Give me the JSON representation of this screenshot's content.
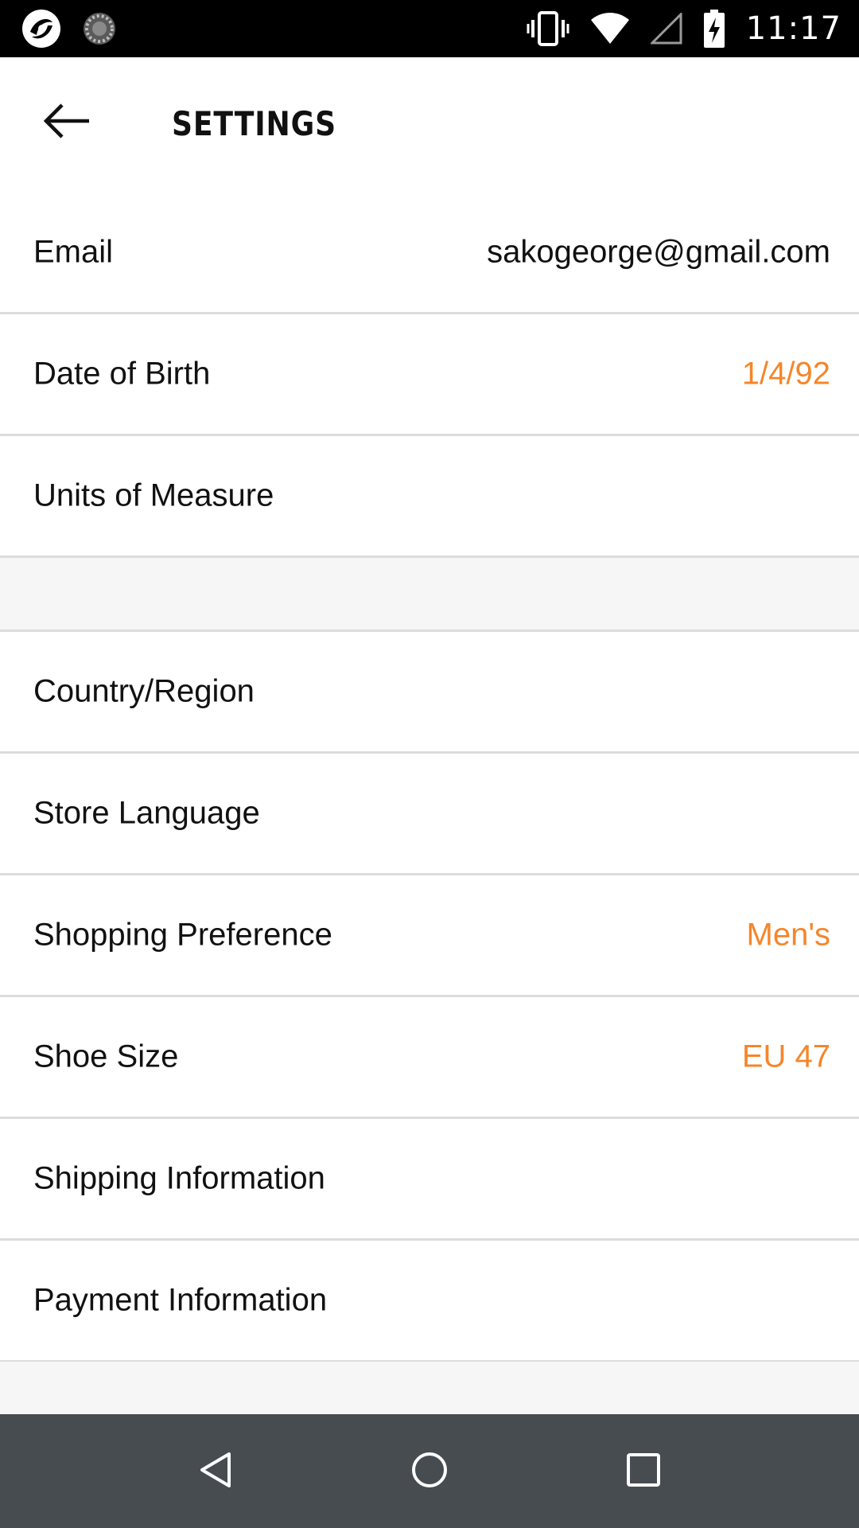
{
  "status_bar": {
    "time": "11:17",
    "icons": [
      "app-notification-icon",
      "sync-spinner-icon",
      "vibrate-icon",
      "wifi-icon",
      "cell-signal-icon",
      "battery-charging-icon"
    ]
  },
  "header": {
    "title": "SETTINGS",
    "back_icon": "arrow-left-icon"
  },
  "settings": {
    "email": {
      "label": "Email",
      "value": "sakogeorge@gmail.com"
    },
    "date_of_birth": {
      "label": "Date of Birth",
      "value": "1/4/92"
    },
    "units_of_measure": {
      "label": "Units of Measure"
    },
    "country_region": {
      "label": "Country/Region"
    },
    "store_language": {
      "label": "Store Language"
    },
    "shopping_preference": {
      "label": "Shopping Preference",
      "value": "Men's"
    },
    "shoe_size": {
      "label": "Shoe Size",
      "value": "EU 47"
    },
    "shipping_information": {
      "label": "Shipping Information"
    },
    "payment_information": {
      "label": "Payment Information"
    }
  },
  "nav_bar": {
    "icons": [
      "nav-back-icon",
      "nav-home-icon",
      "nav-recents-icon"
    ]
  },
  "colors": {
    "accent": "#f5862b",
    "status_bar": "#000000",
    "nav_bar": "#474c51",
    "divider": "#dcdcdc",
    "section_bg": "#f6f6f6"
  }
}
